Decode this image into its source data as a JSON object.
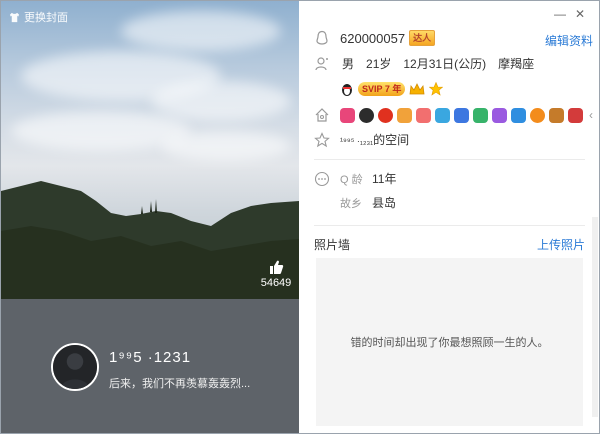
{
  "cover": {
    "change_cover_label": "更换封面",
    "like_count": "54649",
    "nickname": "1⁹⁹5 ·1231",
    "signature": "后来，我们不再羡慕轰轰烈..."
  },
  "window": {
    "minimize_glyph": "—",
    "close_glyph": "✕"
  },
  "profile": {
    "qq_number": "620000057",
    "qq_tag": "达人",
    "edit_label": "编辑资料",
    "gender": "男",
    "age": "21岁",
    "birthday": "12月31日(公历)",
    "zodiac": "摩羯座",
    "vip_label": "SVIP 7 年",
    "space_name_prefix": "¹⁹⁹⁵ ·₁₂₃₁",
    "space_name_suffix": "的空间",
    "q_age_label": "Q 龄",
    "q_age_value": "11年",
    "hometown_label": "故乡",
    "hometown_value": "县岛"
  },
  "photos": {
    "title": "照片墙",
    "upload_label": "上传照片",
    "empty_text": "错的时间却出现了你最想照顾一生的人。"
  },
  "colors": {
    "accent": "#2b7bd6",
    "cover_bottom": "#5e6369",
    "photo_bg": "#f4f4f4"
  },
  "badge_icons": [
    "heart-badge",
    "person-badge",
    "red-diamond-badge",
    "gift-badge",
    "envelope-badge",
    "chat-badge",
    "star-badge",
    "green-diamond-badge",
    "blue-diamond-badge",
    "qq-badge",
    "orange-badge",
    "bag-badge",
    "trophy-badge"
  ]
}
